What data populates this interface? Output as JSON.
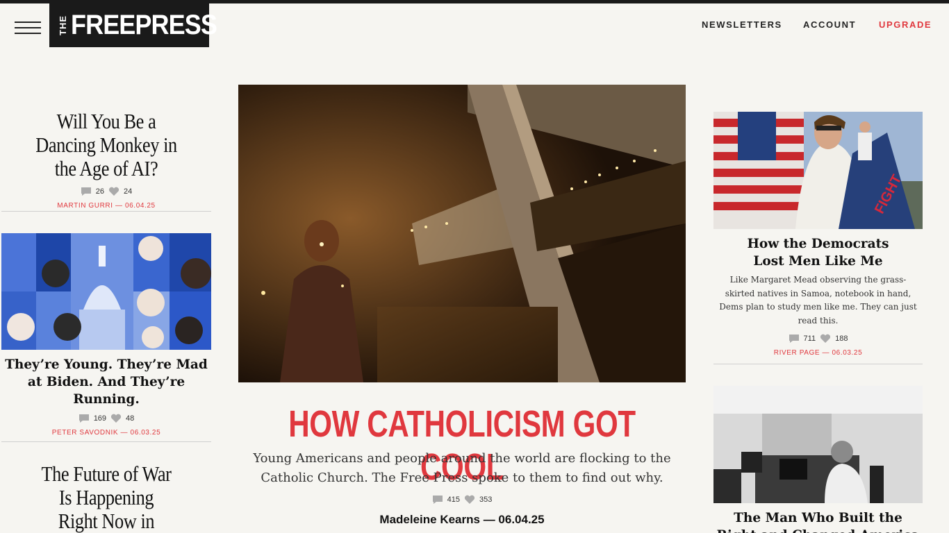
{
  "header": {
    "logo_the": "THE",
    "logo_name": "FREEPRESS",
    "nav": {
      "newsletters": "NEWSLETTERS",
      "account": "ACCOUNT",
      "upgrade": "UPGRADE"
    }
  },
  "left": {
    "article1": {
      "title": "Will You Be a Dancing Monkey in the Age of AI?",
      "comments": "26",
      "likes": "24",
      "byline": "MARTIN GURRI — 06.04.25"
    },
    "article2": {
      "title": "They’re Young. They’re Mad at Biden. And They’re Running.",
      "comments": "169",
      "likes": "48",
      "byline": "PETER SAVODNIK — 06.03.25"
    },
    "article3": {
      "title": "The Future of War Is Happening Right Now in Ukraine"
    }
  },
  "hero": {
    "title": "HOW CATHOLICISM GOT COOL",
    "dek": "Young Americans and people around the world are flocking to the Catholic Church. The Free Press spoke to them to find out why.",
    "comments": "415",
    "likes": "353",
    "byline": "Madeleine Kearns — 06.04.25"
  },
  "right": {
    "article1": {
      "title": "How the Democrats Lost Men Like Me",
      "dek": "Like Margaret Mead observing the grass-skirted natives in Samoa, notebook in hand, Dems plan to study men like me. They can just read this.",
      "comments": "711",
      "likes": "188",
      "byline": "RIVER PAGE — 06.03.25",
      "flag_text": "FIGHT"
    },
    "article2": {
      "title": "The Man Who Built the Right and Changed America"
    }
  },
  "colors": {
    "accent": "#e0383e",
    "background": "#f6f5f1",
    "header_dark": "#1a1a1a"
  },
  "icons": {
    "comment": "comment-icon",
    "like": "heart-icon",
    "menu": "hamburger-icon"
  }
}
